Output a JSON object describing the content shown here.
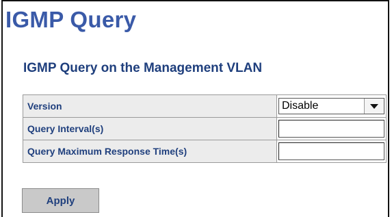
{
  "page": {
    "title": "IGMP Query",
    "section_title": "IGMP Query on the Management VLAN"
  },
  "form": {
    "version": {
      "label": "Version",
      "selected": "Disable"
    },
    "query_interval": {
      "label": "Query Interval(s)",
      "value": ""
    },
    "query_max_response": {
      "label": "Query Maximum Response Time(s)",
      "value": ""
    }
  },
  "actions": {
    "apply_label": "Apply"
  },
  "colors": {
    "title": "#3a5aa8",
    "label_text": "#1f3f7d",
    "label_bg": "#ececec",
    "button_bg": "#c9c9c9"
  }
}
